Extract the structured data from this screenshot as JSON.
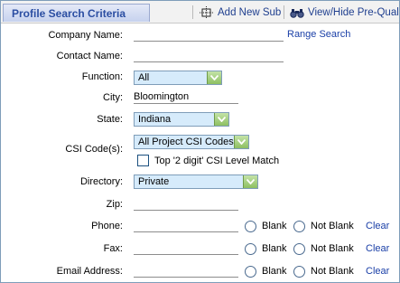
{
  "toolbar": {
    "title": "Profile Search Criteria",
    "add_new_sub": "Add New Sub",
    "view_hide": "View/Hide Pre-Qual C"
  },
  "form": {
    "company_name": {
      "label": "Company Name:",
      "value": "",
      "link": "Range Search"
    },
    "contact_name": {
      "label": "Contact Name:",
      "value": ""
    },
    "function": {
      "label": "Function:",
      "selected": "All"
    },
    "city": {
      "label": "City:",
      "value": "Bloomington"
    },
    "state": {
      "label": "State:",
      "selected": "Indiana"
    },
    "csi_codes": {
      "label": "CSI Code(s):",
      "selected": "All Project CSI Codes",
      "checkbox_label": "Top '2 digit' CSI Level Match",
      "checked": false
    },
    "directory": {
      "label": "Directory:",
      "selected": "Private"
    },
    "zip": {
      "label": "Zip:",
      "value": ""
    },
    "phone": {
      "label": "Phone:",
      "value": ""
    },
    "fax": {
      "label": "Fax:",
      "value": ""
    },
    "email": {
      "label": "Email Address:",
      "value": ""
    },
    "blank_label": "Blank",
    "not_blank_label": "Not Blank",
    "clear_label": "Clear"
  }
}
